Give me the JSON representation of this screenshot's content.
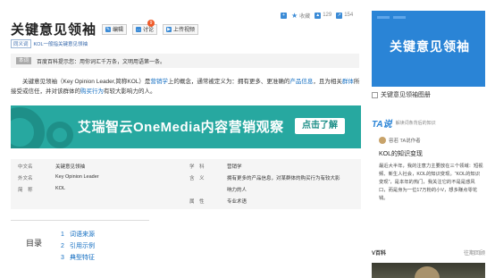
{
  "toolbar": {
    "collect_label": "收藏",
    "like_count": "129",
    "share_count": "154"
  },
  "header": {
    "title": "关键意见领袖",
    "edit_label": "编辑",
    "discuss_label": "讨论",
    "discuss_badge": "9",
    "upload_video_label": "上传视频"
  },
  "synonym": {
    "tag": "同义词",
    "text": "KOL一般指关键意见领袖"
  },
  "tip": {
    "tag": "本词",
    "text": "百度百科提示您：用你词汇千万条，文明用语第一条。"
  },
  "summary": {
    "p1": "关键意见领袖（Key Opinion Leader,简称KOL）是",
    "l1": "营销学",
    "p2": "上的概念，通常被定义为：拥有更多、更准确的",
    "l2": "产品信息",
    "p3": "，且为相关",
    "l3": "群体",
    "p4": "所接受或信任，并对该群体的",
    "l4": "购买行为",
    "p5": "有较大影响力的人。"
  },
  "banner": {
    "text": "艾瑞智云OneMedia内容营销观察",
    "button": "点击了解"
  },
  "infobox": {
    "rows": [
      {
        "k1": "中文名",
        "v1": "关键意见领袖",
        "k2": "学　科",
        "v2": "营销学"
      },
      {
        "k1": "外文名",
        "v1": "Key Opinion Leader",
        "k2": "含　义",
        "v2": "拥有更多的产品信息，对某群体的购买行为有较大影"
      },
      {
        "k1": "简　称",
        "v1": "KOL",
        "k2": "",
        "v2": "响力的人"
      },
      {
        "k1": "",
        "v1": "",
        "k2": "属　性",
        "v2": "专业术语"
      }
    ]
  },
  "toc": {
    "label": "目录",
    "items": [
      {
        "num": "1",
        "text": "词语来源"
      },
      {
        "num": "2",
        "text": "引用示例"
      },
      {
        "num": "3",
        "text": "典型特征"
      }
    ]
  },
  "right": {
    "album_text": "关键意见领袖",
    "album_caption": "关键意见领袖图册",
    "ta_logo": "TA说",
    "ta_sub": "解读词条背后的知识",
    "ta_author": "容若 TA说作者",
    "ta_title": "KOL的知识变现",
    "ta_body": "最近大半年，我的注意力主要放在三个领域：短视频、新生人社会，KOL的知识变现。“KOL的知识变现”，是本年的热门，我关注它的不是是惑风口，而是身为一位17万粉的小V，想多赚点零花钱。",
    "vbaike_label": "V百科",
    "vbaike_more": "往期回顾"
  },
  "colors": {
    "accent": "#2a84d6",
    "banner": "#27a8a0",
    "link": "#136ec2",
    "badge": "#f05a28"
  }
}
